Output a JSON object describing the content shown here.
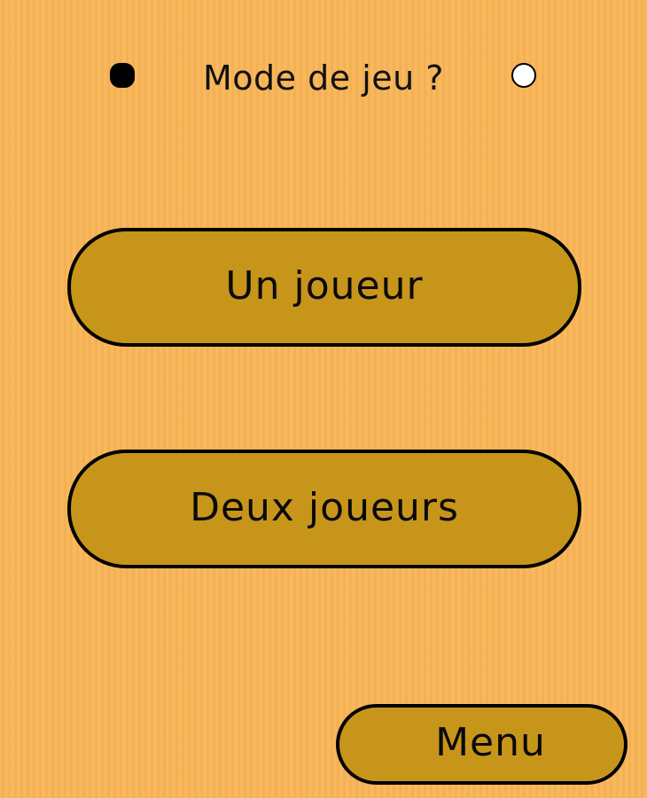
{
  "header": {
    "title": "Mode de jeu ?",
    "left_stone": "black-stone-icon",
    "right_stone": "white-stone-icon"
  },
  "buttons": {
    "one_player": "Un joueur",
    "two_players": "Deux joueurs",
    "menu": "Menu"
  },
  "colors": {
    "background": "#f9b556",
    "button_fill": "#c8951b",
    "button_border": "#000000",
    "text": "#111111"
  }
}
